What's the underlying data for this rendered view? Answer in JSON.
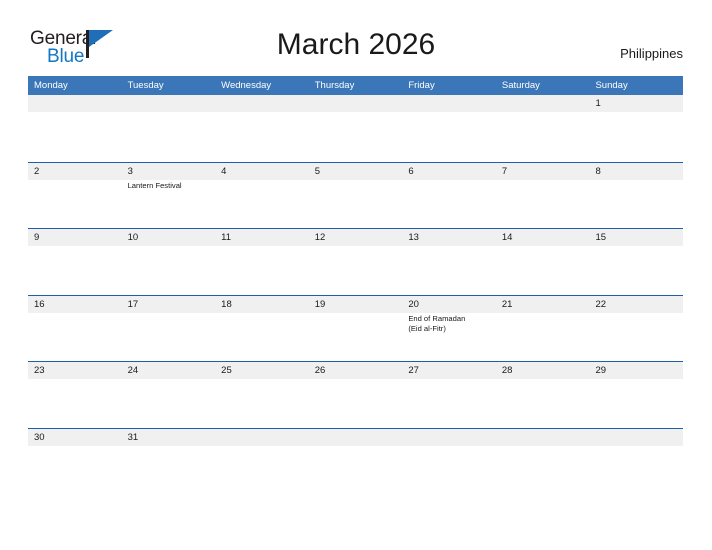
{
  "logo": {
    "word_top": "General",
    "word_bottom": "Blue",
    "flag_color": "#1f6fb8",
    "text_color": "#231f20",
    "blue_text_color": "#1277c4"
  },
  "header": {
    "title": "March 2026",
    "country": "Philippines"
  },
  "colors": {
    "header_blue": "#3a76b8",
    "rule_blue": "#1f5fa8",
    "date_band_gray": "#f0f0f0",
    "text_dark": "#1a1a1a"
  },
  "calendar": {
    "weekdays": [
      "Monday",
      "Tuesday",
      "Wednesday",
      "Thursday",
      "Friday",
      "Saturday",
      "Sunday"
    ],
    "weeks": [
      {
        "dates": [
          "",
          "",
          "",
          "",
          "",
          "",
          "1"
        ],
        "events": [
          "",
          "",
          "",
          "",
          "",
          "",
          ""
        ]
      },
      {
        "dates": [
          "2",
          "3",
          "4",
          "5",
          "6",
          "7",
          "8"
        ],
        "events": [
          "",
          "Lantern Festival",
          "",
          "",
          "",
          "",
          ""
        ]
      },
      {
        "dates": [
          "9",
          "10",
          "11",
          "12",
          "13",
          "14",
          "15"
        ],
        "events": [
          "",
          "",
          "",
          "",
          "",
          "",
          ""
        ]
      },
      {
        "dates": [
          "16",
          "17",
          "18",
          "19",
          "20",
          "21",
          "22"
        ],
        "events": [
          "",
          "",
          "",
          "",
          "End of Ramadan\n(Eid al-Fitr)",
          "",
          ""
        ]
      },
      {
        "dates": [
          "23",
          "24",
          "25",
          "26",
          "27",
          "28",
          "29"
        ],
        "events": [
          "",
          "",
          "",
          "",
          "",
          "",
          ""
        ]
      },
      {
        "dates": [
          "30",
          "31",
          "",
          "",
          "",
          "",
          ""
        ],
        "events": [
          "",
          "",
          "",
          "",
          "",
          "",
          ""
        ]
      }
    ]
  }
}
